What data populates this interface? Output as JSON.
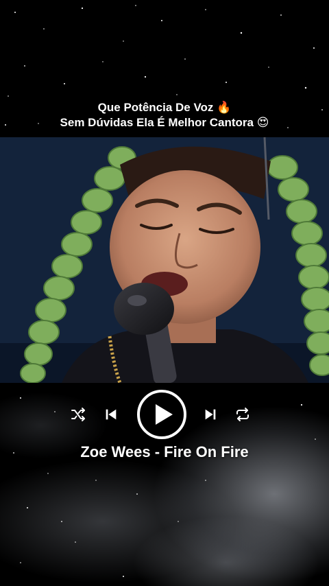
{
  "caption": {
    "line1": "Que Potência De Voz 🔥",
    "line2": "Sem Dúvidas Ela É Melhor Cantora 😍"
  },
  "player": {
    "shuffle_icon": "shuffle-icon",
    "prev_icon": "skip-previous-icon",
    "play_icon": "play-icon",
    "next_icon": "skip-next-icon",
    "repeat_icon": "repeat-icon"
  },
  "song": {
    "title": "Zoe Wees - Fire On Fire"
  },
  "colors": {
    "background": "#000000",
    "text": "#ffffff",
    "video_bg": "#14243d",
    "braids": "#7fae5c"
  }
}
